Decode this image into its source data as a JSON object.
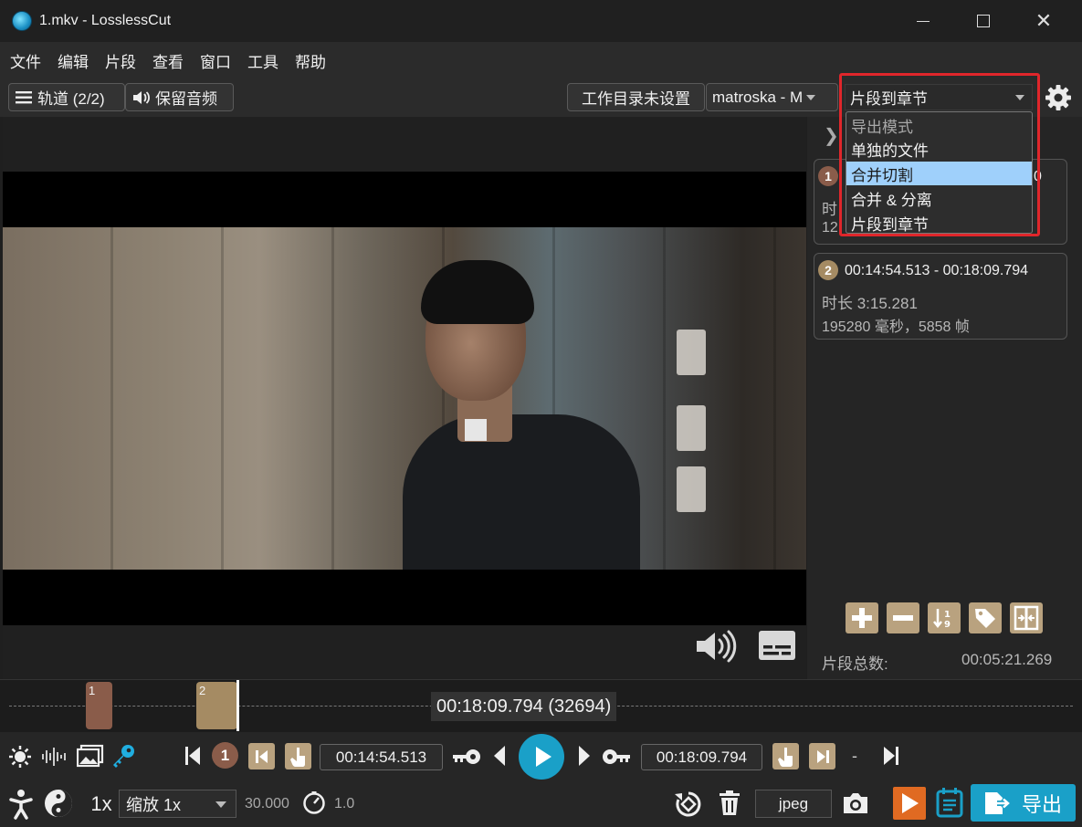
{
  "window": {
    "title": "1.mkv - LosslessCut"
  },
  "menu": [
    "文件",
    "编辑",
    "片段",
    "查看",
    "窗口",
    "工具",
    "帮助"
  ],
  "toolbar": {
    "tracks_label": "轨道 (2/2)",
    "audio_label": "保留音频",
    "workdir_label": "工作目录未设置",
    "format_value": "matroska - M",
    "export_mode_value": "片段到章节"
  },
  "export_mode_dropdown": {
    "options": [
      {
        "label": "导出模式",
        "disabled": true
      },
      {
        "label": "单独的文件"
      },
      {
        "label": "合并切割",
        "highlighted": true
      },
      {
        "label": "合并 & 分离"
      },
      {
        "label": "片段到章节"
      }
    ]
  },
  "segments": [
    {
      "number": "1",
      "color": "#8a5c4a",
      "range_partial": "0",
      "duration_partial": "时",
      "ms_partial": "12"
    },
    {
      "number": "2",
      "color": "#a58b63",
      "range": "00:14:54.513 - 00:18:09.794",
      "duration": "时长 3:15.281",
      "ms_frames": "195280 毫秒，5858 帧"
    }
  ],
  "segment_tools": [
    "plus-icon",
    "minus-icon",
    "sort-icon",
    "tag-icon",
    "split-icon"
  ],
  "segment_total": {
    "label": "片段总数:",
    "value": "00:05:21.269"
  },
  "timeline": {
    "current_time": "00:18:09.794 (32694)",
    "segment_labels": [
      "1",
      "2"
    ]
  },
  "controls": {
    "segment_badge": "1",
    "start_time": "00:14:54.513",
    "end_time": "00:18:09.794",
    "dash": "-",
    "speed": "1x",
    "zoom_value": "缩放 1x",
    "fps": "30.000",
    "playback_rate": "1.0",
    "snapshot_format": "jpeg",
    "export_label": "导出"
  },
  "colors": {
    "accent": "#1aa0c8",
    "segment_tan": "#b9a27f",
    "highlight": "#9fd0fb",
    "annotation_red": "#e0262b"
  }
}
